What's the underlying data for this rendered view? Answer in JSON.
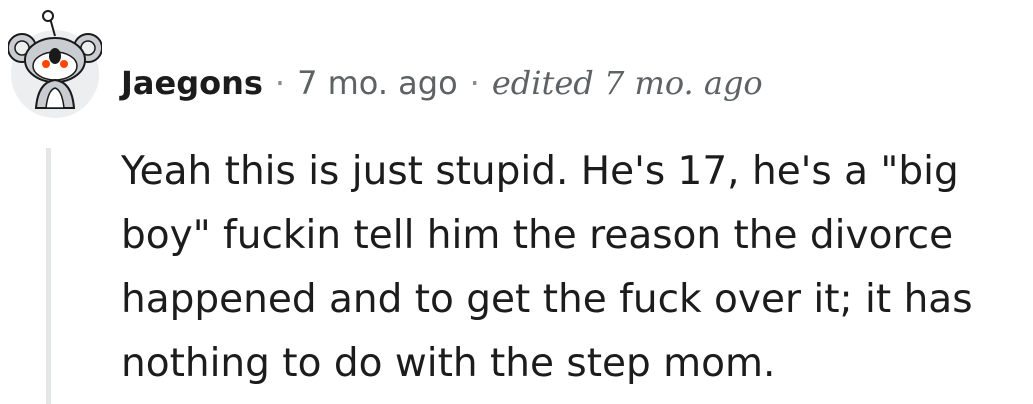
{
  "comment": {
    "author": "Jaegons",
    "separator": "·",
    "time": "7 mo. ago",
    "edited": "edited 7 mo. ago",
    "avatar_icon": "koala-snoo-avatar-icon",
    "body": "Yeah this is just stupid. He's 17, he's a \"big boy\" fuckin tell him the reason the divorce happened and to get the fuck over it; it has nothing to do with the step mom."
  },
  "colors": {
    "text": "#1c1c1c",
    "meta_text": "#5f6265",
    "thread_line": "#e4e6e8",
    "avatar_accent": "#ff4500"
  }
}
